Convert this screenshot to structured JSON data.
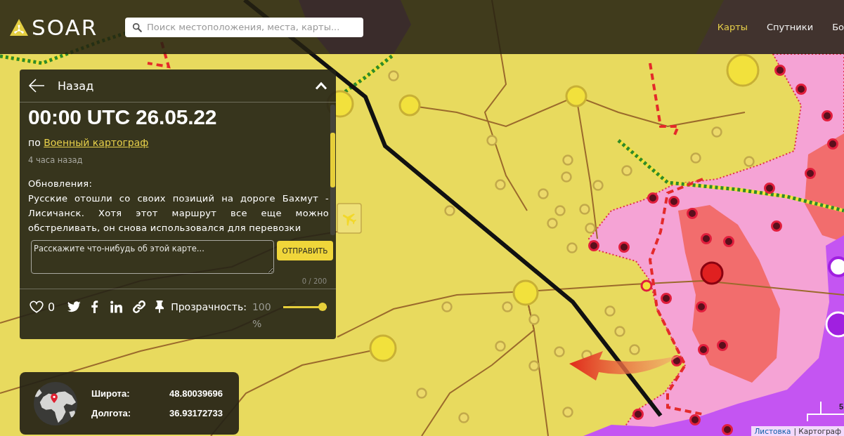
{
  "header": {
    "logo": "SOAR",
    "search": {
      "placeholder": "Поиск местоположения, места, карты..."
    },
    "nav": [
      {
        "label": "Карты",
        "selected": true
      },
      {
        "label": "Спутники",
        "selected": false
      },
      {
        "label": "Бо",
        "selected": false
      }
    ]
  },
  "panel": {
    "back": "Назад",
    "expanded": true,
    "title": "00:00 UTC 26.05.22",
    "byline": {
      "prefix": "по",
      "author": "Военный картограф"
    },
    "time_ago": "4 часа назад",
    "heading": "Обновления:",
    "body": "Русские отошли со своих позиций на дороге Бахмут - Лисичанск. Хотя этот маршрут все еще можно обстреливать, он снова использовался для перевозки",
    "comment": {
      "placeholder": "Расскажите что-нибудь об этой карте...",
      "submit": "ОТПРАВИТЬ",
      "counter": "0 / 200"
    },
    "actions": {
      "likes": "0",
      "liked": false,
      "opacity": {
        "label": "Прозрачность:",
        "reading": "100 %",
        "level": 1
      }
    }
  },
  "coordinates": [
    {
      "label": "Широта:",
      "value": "48.80039696"
    },
    {
      "label": "Долгота:",
      "value": "36.93172733"
    }
  ],
  "map": {
    "scale_label": "5",
    "attribution": {
      "link": "Листовка",
      "text": "| Картограф"
    }
  }
}
